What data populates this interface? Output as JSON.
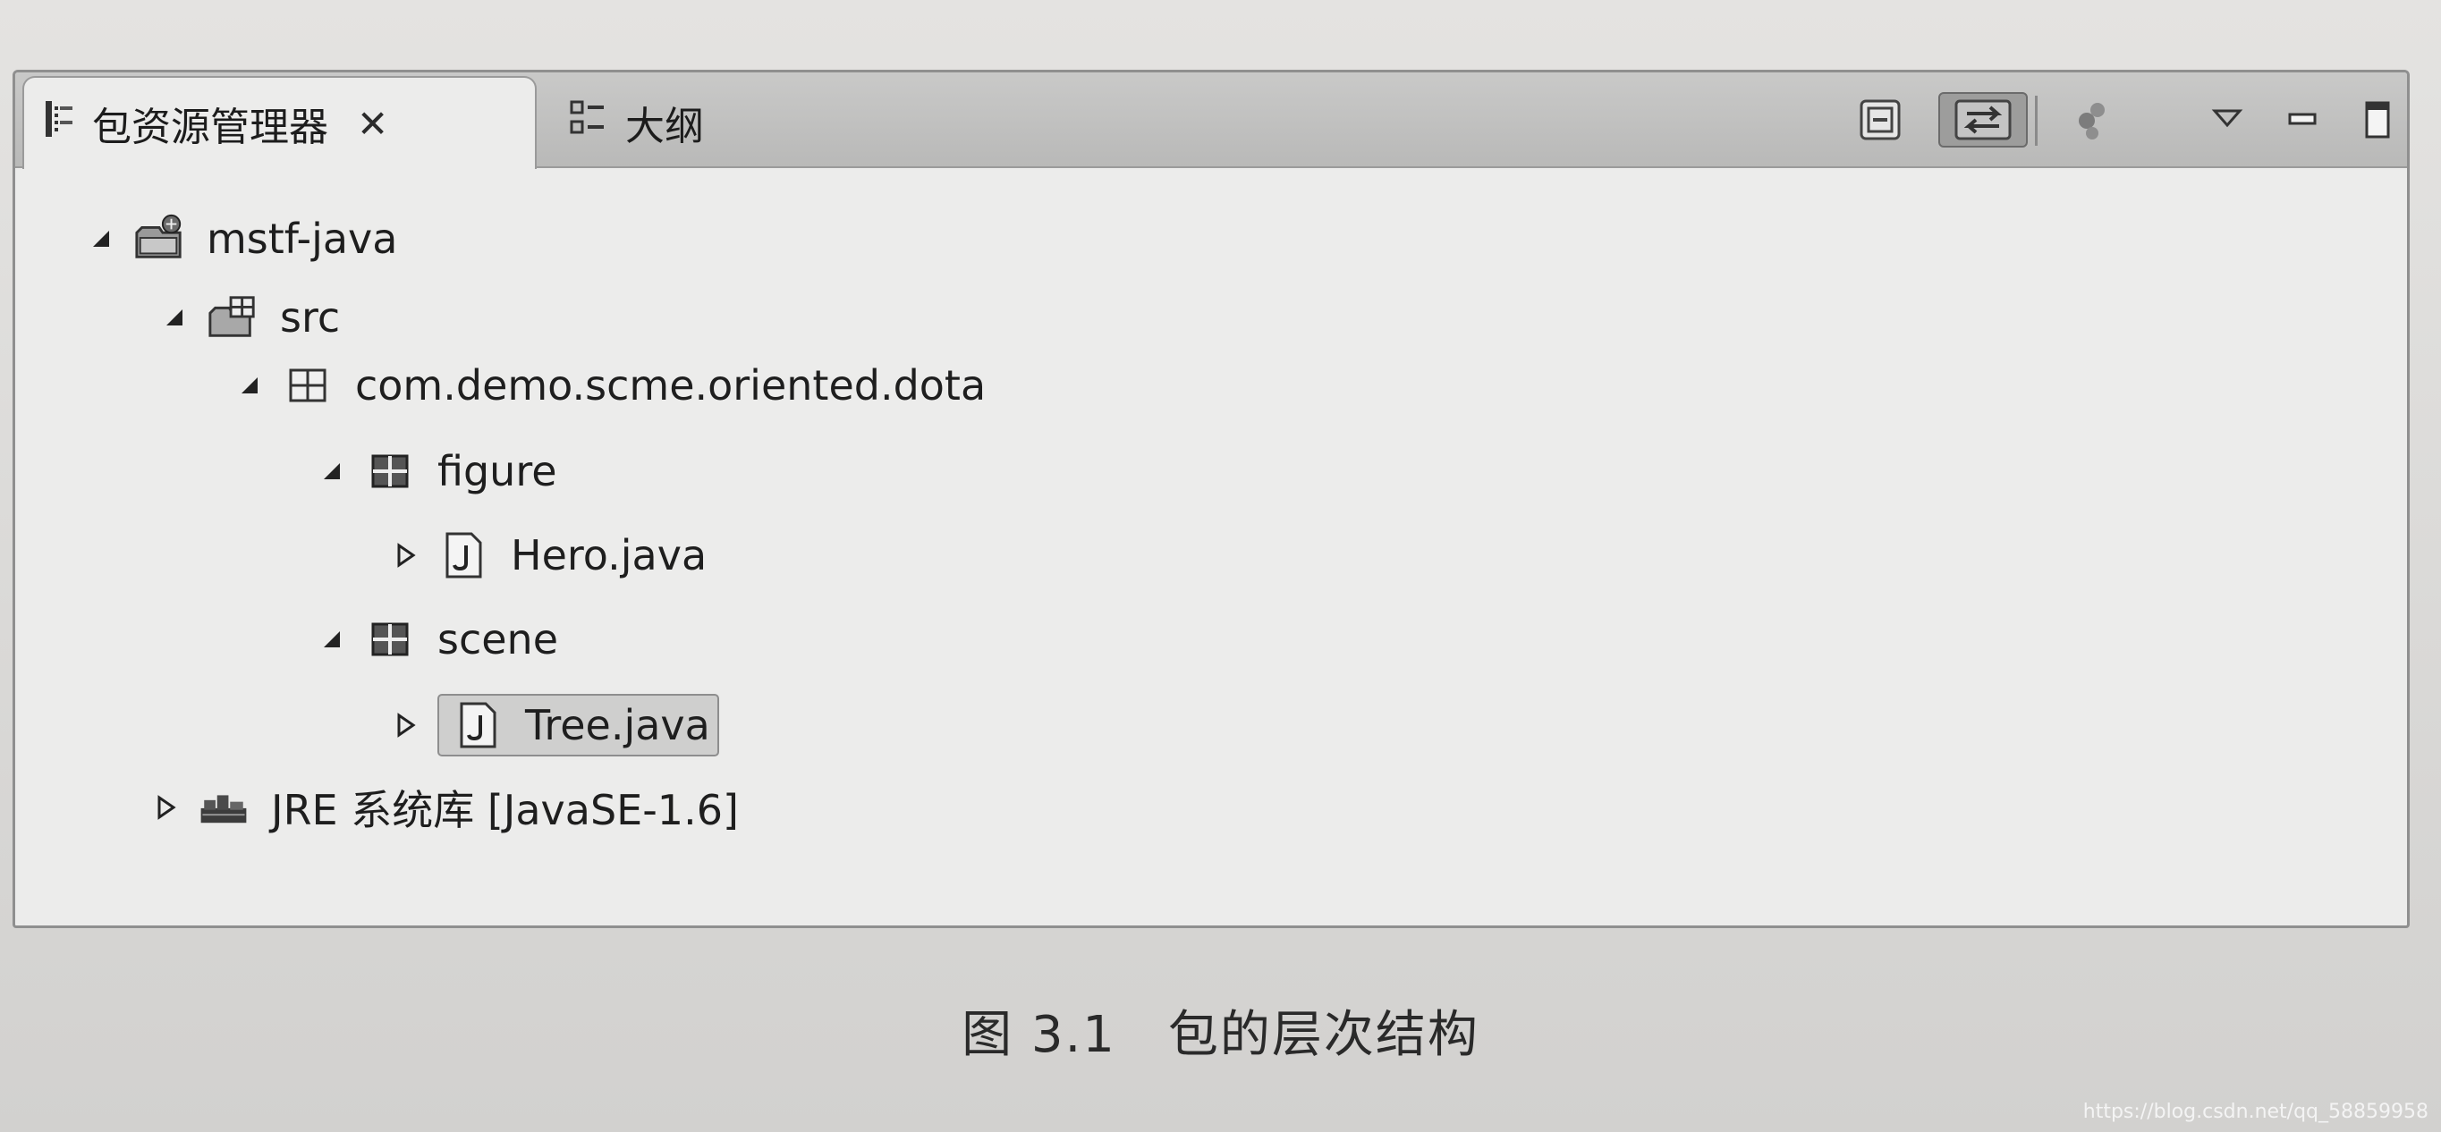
{
  "tabs": [
    {
      "label": "包资源管理器",
      "icon": "package-explorer-icon",
      "active": true,
      "close_symbol": "✕"
    },
    {
      "label": "大纲",
      "icon": "outline-icon",
      "active": false
    }
  ],
  "tree": {
    "project": {
      "label": "mstf-java",
      "expanded": true
    },
    "src": {
      "label": "src",
      "expanded": true
    },
    "pkg_root": {
      "label": "com.demo.scme.oriented.dota",
      "expanded": true
    },
    "pkg_figure": {
      "label": "figure",
      "expanded": true
    },
    "file_hero": {
      "label": "Hero.java",
      "expanded": false
    },
    "pkg_scene": {
      "label": "scene",
      "expanded": true
    },
    "file_tree": {
      "label": "Tree.java",
      "expanded": false,
      "selected": true
    },
    "jre": {
      "label": "JRE 系统库 [JavaSE-1.6]",
      "expanded": false
    }
  },
  "caption": "图 3.1　包的层次结构",
  "watermark": "https://blog.csdn.net/qq_58859958",
  "colors": {
    "panel_bg": "#ececeb",
    "tabbar_bg": "#bfbfbe",
    "border": "#8f8f8f",
    "text": "#1e1e1e"
  }
}
